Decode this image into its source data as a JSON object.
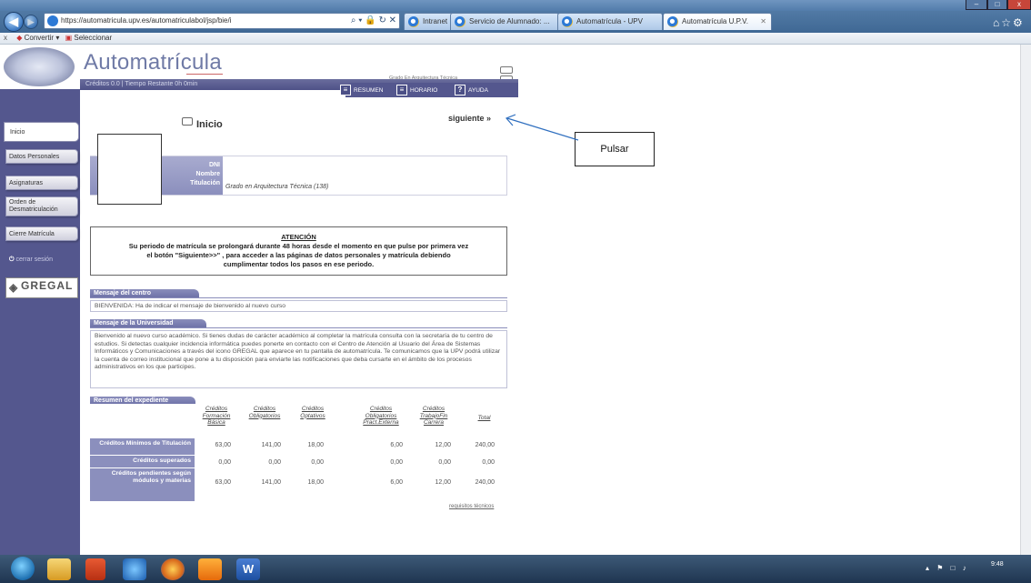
{
  "browser": {
    "url": "https://automatricula.upv.es/automatriculabol/jsp/bie/i",
    "address_controls": "⌕ ▾ 🔒 ↻ ✕",
    "tabs": [
      {
        "label": "Intranet UPV"
      },
      {
        "label": "Servicio de Alumnado: ..."
      },
      {
        "label": "Automatrícula - UPV"
      },
      {
        "label": "Automatrícula U.P.V."
      }
    ],
    "tab_close": "✕",
    "cmdbar": {
      "close": "x",
      "convert_label": "Convertir",
      "select_label": "Seleccionar"
    },
    "window_controls": [
      "–",
      "□",
      "x"
    ]
  },
  "header": {
    "title": "Automatrícula",
    "subheader": "Créditos 0.0 | Tiempo Restante 0h 0min",
    "degree_check": "Grado En Arquitectura Técnica",
    "buttons": [
      {
        "label": "RESUMEN",
        "icon": "≡"
      },
      {
        "label": "HORARIO",
        "icon": "≡"
      },
      {
        "label": "AYUDA",
        "icon": "?"
      }
    ]
  },
  "sidebar": {
    "items": [
      "Inicio",
      "Datos Personales",
      "Asignaturas",
      "Orden de Desmatriculación",
      "Cierre Matrícula"
    ],
    "close_session": "cerrar sesión",
    "close_icon": "⏻",
    "brand": "GREGAL"
  },
  "main": {
    "page_title": "Inicio",
    "next_link": "siguiente »",
    "info": {
      "dni_label": "DNI",
      "nombre_label": "Nombre",
      "titulacion_label": "Titulación",
      "titulacion_value": "Grado en Arquitectura Técnica (138)"
    },
    "attention": {
      "title": "ATENCIÓN",
      "line1": "Su periodo de matrícula se prolongará durante 48 horas desde el momento en que pulse por primera vez",
      "line2": "el botón \"Siguiente>>\" , para acceder a las páginas de datos personales y matrícula debiendo",
      "line3": "cumplimentar todos los pasos en ese periodo."
    },
    "centro": {
      "header": "Mensaje del centro",
      "body": "BIENVENIDA: Ha de indicar el mensaje de bienvenido al nuevo curso"
    },
    "universidad": {
      "header": "Mensaje de la Universidad",
      "body": "Bienvenido al nuevo curso académico. Si tienes dudas de carácter académico al completar la matrícula consulta con la secretaría de tu centro de estudios. Si detectas cualquier incidencia informática puedes ponerte en contacto con el Centro de Atención al Usuario del Área de Sistemas Informáticos y Comunicaciones a través del icono GREGAL que aparece en tu pantalla de automatrícula. Te comunicamos que la UPV podrá utilizar la cuenta de correo institucional que pone a tu disposición para enviarte las notificaciones que deba cursarte en el ámbito de los procesos administrativos en los que participes."
    },
    "resumen": {
      "header": "Resumen del expediente",
      "columns": [
        "Créditos Formación Básica",
        "Créditos Obligatorios",
        "Créditos Optativos",
        "Créditos Obligatorios Pract.Externa",
        "Créditos TrabajoFin Carrera",
        "Total"
      ],
      "rows": [
        {
          "label": "Créditos Mínimos de Titulación",
          "values": [
            "63,00",
            "141,00",
            "18,00",
            "6,00",
            "12,00",
            "240,00"
          ]
        },
        {
          "label": "Créditos superados",
          "values": [
            "0,00",
            "0,00",
            "0,00",
            "0,00",
            "0,00",
            "0,00"
          ]
        },
        {
          "label": "Créditos pendientes según módulos y materias",
          "values": [
            "63,00",
            "141,00",
            "18,00",
            "6,00",
            "12,00",
            "240,00"
          ]
        }
      ]
    },
    "requirements_link": "requisitos técnicos"
  },
  "annotation": {
    "label": "Pulsar"
  },
  "taskbar": {
    "time": "9:48",
    "tray_icons": "▴ ⚑ □ ♪"
  },
  "colors": {
    "accent": "#54578e",
    "header_text": "#6f7aa6",
    "chrome": "#3f6894",
    "arrow": "#2f6fbf"
  }
}
